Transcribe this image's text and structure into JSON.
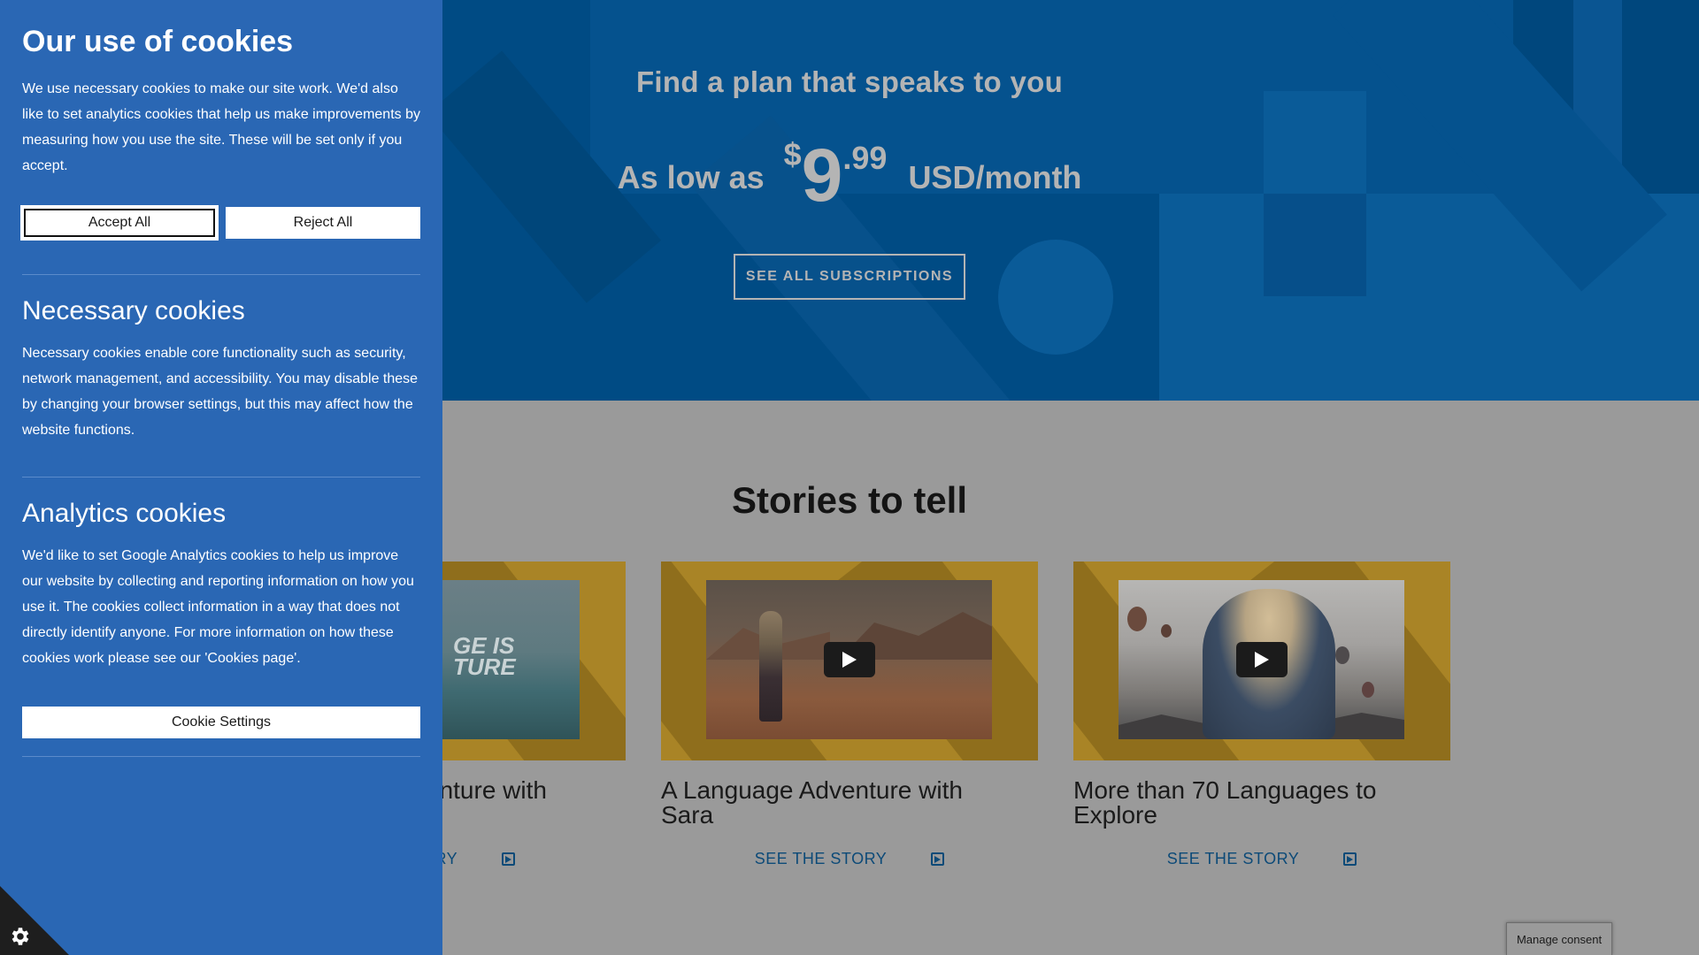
{
  "hero": {
    "title": "Find a plan that speaks to you",
    "price_lead": "As low as",
    "currency": "$",
    "price_whole": "9",
    "price_cents": ".99",
    "price_unit": "USD/month",
    "subscriptions_button": "SEE ALL SUBSCRIPTIONS"
  },
  "stories": {
    "title": "Stories to tell",
    "cards": [
      {
        "title": "A Language Adventure with Sara",
        "link": "SEE THE STORY"
      },
      {
        "title": "A Language Adventure with Sara",
        "link": "SEE THE STORY"
      },
      {
        "title": "More than 70 Languages to Explore",
        "link": "SEE THE STORY"
      }
    ],
    "partial_card": {
      "title": "enture with",
      "link": "ORY",
      "thumb_text": "GE IS TURE"
    }
  },
  "cookie_panel": {
    "title": "Our use of cookies",
    "intro": "We use necessary cookies to make our site work. We'd also like to set analytics cookies that help us make improvements by measuring how you use the site. These will be set only if you accept.",
    "accept_label": "Accept All",
    "reject_label": "Reject All",
    "necessary_title": "Necessary cookies",
    "necessary_text": "Necessary cookies enable core functionality such as security, network management, and accessibility. You may disable these by changing your browser settings, but this may affect how the website functions.",
    "analytics_title": "Analytics cookies",
    "analytics_text": "We'd like to set Google Analytics cookies to help us improve our website by collecting and reporting information on how you use it. The cookies collect information in a way that does not directly identify anyone. For more information on how these cookies work please see our 'Cookies page'.",
    "settings_label": "Cookie Settings"
  },
  "manage_consent": {
    "label": "Manage consent"
  },
  "icons": {
    "gear": "gear-icon",
    "play": "play-icon",
    "story": "play-square-icon"
  },
  "colors": {
    "hero_bg": "#004b84",
    "panel_bg": "#2a67b4",
    "card_frame": "#a98426",
    "link": "#0c4a78"
  }
}
